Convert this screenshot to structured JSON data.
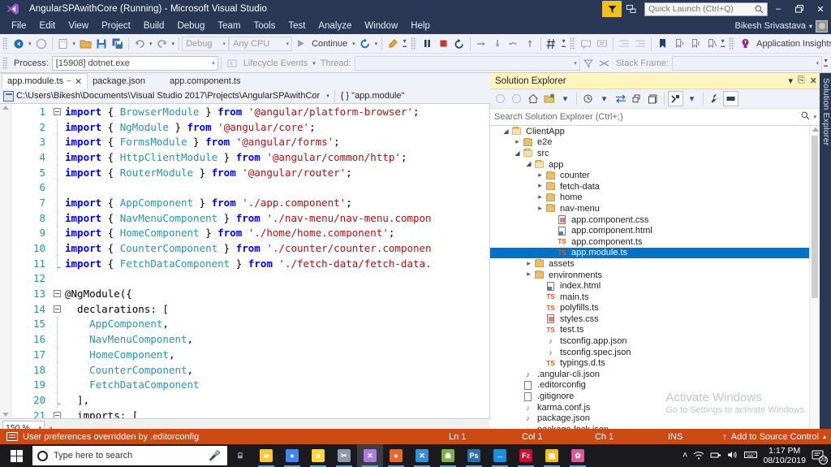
{
  "window": {
    "title": "AngularSPAwithCore (Running) - Microsoft Visual Studio",
    "minimize_label": "–",
    "restore_label": "❐",
    "close_label": "✕"
  },
  "menu": {
    "items": [
      "File",
      "Edit",
      "View",
      "Project",
      "Build",
      "Debug",
      "Team",
      "Tools",
      "Test",
      "Analyze",
      "Window",
      "Help"
    ],
    "user_name": "Bikesh Srivastava",
    "user_caret": "▾"
  },
  "quick_launch": {
    "placeholder": "Quick Launch (Ctrl+Q)"
  },
  "toolbar_main": {
    "navigate_back": "◀",
    "debug_config": "Debug",
    "platform": "Any CPU",
    "continue_label": "Continue",
    "restart": "↻",
    "pause": "‖",
    "stop": "■",
    "app_insights": "Application Insights",
    "caret": "▾"
  },
  "toolbar_debug": {
    "process_label": "Process:",
    "process_value": "[15908] dotnet.exe",
    "lifecycle_label": "Lifecycle Events",
    "thread_label": "Thread:",
    "thread_value": "",
    "stackframe_label": "Stack Frame:",
    "stackframe_value": ""
  },
  "tabs": [
    {
      "label": "app.module.ts",
      "active": true,
      "pin": "−",
      "close": "✕"
    },
    {
      "label": "package.json",
      "active": false
    },
    {
      "label": "app.component.ts",
      "active": false
    }
  ],
  "pathbar": {
    "path": "C:\\Users\\Bikesh\\Documents\\Visual Studio 2017\\Projects\\AngularSPAwithCor",
    "caret": "▾",
    "symbol": "{ }  \"app.module\""
  },
  "editor": {
    "zoom": "150 %",
    "lines": [
      {
        "n": "1",
        "fold": "minus",
        "tokens": [
          {
            "t": "import",
            "c": "k-import"
          },
          {
            "t": " { ",
            "c": "k-punct"
          },
          {
            "t": "BrowserModule",
            "c": "k-type"
          },
          {
            "t": " } ",
            "c": "k-punct"
          },
          {
            "t": "from",
            "c": "k-import"
          },
          {
            "t": " ",
            "c": "k-plain"
          },
          {
            "t": "'@angular/platform-browser'",
            "c": "k-str"
          },
          {
            "t": ";",
            "c": "k-punct"
          }
        ]
      },
      {
        "n": "2",
        "fold": "line",
        "tokens": [
          {
            "t": "import",
            "c": "k-import"
          },
          {
            "t": " { ",
            "c": "k-punct"
          },
          {
            "t": "NgModule",
            "c": "k-type"
          },
          {
            "t": " } ",
            "c": "k-punct"
          },
          {
            "t": "from",
            "c": "k-import"
          },
          {
            "t": " ",
            "c": "k-plain"
          },
          {
            "t": "'@angular/core'",
            "c": "k-str"
          },
          {
            "t": ";",
            "c": "k-punct"
          }
        ]
      },
      {
        "n": "3",
        "fold": "line",
        "tokens": [
          {
            "t": "import",
            "c": "k-import"
          },
          {
            "t": " { ",
            "c": "k-punct"
          },
          {
            "t": "FormsModule",
            "c": "k-type"
          },
          {
            "t": " } ",
            "c": "k-punct"
          },
          {
            "t": "from",
            "c": "k-import"
          },
          {
            "t": " ",
            "c": "k-plain"
          },
          {
            "t": "'@angular/forms'",
            "c": "k-str"
          },
          {
            "t": ";",
            "c": "k-punct"
          }
        ]
      },
      {
        "n": "4",
        "fold": "line",
        "tokens": [
          {
            "t": "import",
            "c": "k-import"
          },
          {
            "t": " { ",
            "c": "k-punct"
          },
          {
            "t": "HttpClientModule",
            "c": "k-type"
          },
          {
            "t": " } ",
            "c": "k-punct"
          },
          {
            "t": "from",
            "c": "k-import"
          },
          {
            "t": " ",
            "c": "k-plain"
          },
          {
            "t": "'@angular/common/http'",
            "c": "k-str"
          },
          {
            "t": ";",
            "c": "k-punct"
          }
        ]
      },
      {
        "n": "5",
        "fold": "line",
        "tokens": [
          {
            "t": "import",
            "c": "k-import"
          },
          {
            "t": " { ",
            "c": "k-punct"
          },
          {
            "t": "RouterModule",
            "c": "k-type"
          },
          {
            "t": " } ",
            "c": "k-punct"
          },
          {
            "t": "from",
            "c": "k-import"
          },
          {
            "t": " ",
            "c": "k-plain"
          },
          {
            "t": "'@angular/router'",
            "c": "k-str"
          },
          {
            "t": ";",
            "c": "k-punct"
          }
        ]
      },
      {
        "n": "6",
        "fold": "dot",
        "tokens": []
      },
      {
        "n": "7",
        "fold": "line",
        "tokens": [
          {
            "t": "import",
            "c": "k-import"
          },
          {
            "t": " { ",
            "c": "k-punct"
          },
          {
            "t": "AppComponent",
            "c": "k-type"
          },
          {
            "t": " } ",
            "c": "k-punct"
          },
          {
            "t": "from",
            "c": "k-import"
          },
          {
            "t": " ",
            "c": "k-plain"
          },
          {
            "t": "'./app.component'",
            "c": "k-str"
          },
          {
            "t": ";",
            "c": "k-punct"
          }
        ]
      },
      {
        "n": "8",
        "fold": "line",
        "tokens": [
          {
            "t": "import",
            "c": "k-import"
          },
          {
            "t": " { ",
            "c": "k-punct"
          },
          {
            "t": "NavMenuComponent",
            "c": "k-type"
          },
          {
            "t": " } ",
            "c": "k-punct"
          },
          {
            "t": "from",
            "c": "k-import"
          },
          {
            "t": " ",
            "c": "k-plain"
          },
          {
            "t": "'./nav-menu/nav-menu.compon",
            "c": "k-str"
          }
        ]
      },
      {
        "n": "9",
        "fold": "line",
        "tokens": [
          {
            "t": "import",
            "c": "k-import"
          },
          {
            "t": " { ",
            "c": "k-punct"
          },
          {
            "t": "HomeComponent",
            "c": "k-type"
          },
          {
            "t": " } ",
            "c": "k-punct"
          },
          {
            "t": "from",
            "c": "k-import"
          },
          {
            "t": " ",
            "c": "k-plain"
          },
          {
            "t": "'./home/home.component'",
            "c": "k-str"
          },
          {
            "t": ";",
            "c": "k-punct"
          }
        ]
      },
      {
        "n": "10",
        "fold": "line",
        "tokens": [
          {
            "t": "import",
            "c": "k-import"
          },
          {
            "t": " { ",
            "c": "k-punct"
          },
          {
            "t": "CounterComponent",
            "c": "k-type"
          },
          {
            "t": " } ",
            "c": "k-punct"
          },
          {
            "t": "from",
            "c": "k-import"
          },
          {
            "t": " ",
            "c": "k-plain"
          },
          {
            "t": "'./counter/counter.componen",
            "c": "k-str"
          }
        ]
      },
      {
        "n": "11",
        "fold": "line-end",
        "tokens": [
          {
            "t": "import",
            "c": "k-import"
          },
          {
            "t": " { ",
            "c": "k-punct"
          },
          {
            "t": "FetchDataComponent",
            "c": "k-type"
          },
          {
            "t": " } ",
            "c": "k-punct"
          },
          {
            "t": "from",
            "c": "k-import"
          },
          {
            "t": " ",
            "c": "k-plain"
          },
          {
            "t": "'./fetch-data/fetch-data.",
            "c": "k-str"
          }
        ]
      },
      {
        "n": "12",
        "fold": "none",
        "tokens": []
      },
      {
        "n": "13",
        "fold": "minus",
        "tokens": [
          {
            "t": "@NgModule({",
            "c": "k-decor"
          }
        ]
      },
      {
        "n": "14",
        "fold": "minus-inner",
        "tokens": [
          {
            "t": "  declarations: [",
            "c": "k-plain"
          }
        ]
      },
      {
        "n": "15",
        "fold": "dot-inner",
        "tokens": [
          {
            "t": "    ",
            "c": "k-plain"
          },
          {
            "t": "AppComponent",
            "c": "k-type"
          },
          {
            "t": ",",
            "c": "k-punct"
          }
        ]
      },
      {
        "n": "16",
        "fold": "dot-inner",
        "tokens": [
          {
            "t": "    ",
            "c": "k-plain"
          },
          {
            "t": "NavMenuComponent",
            "c": "k-type"
          },
          {
            "t": ",",
            "c": "k-punct"
          }
        ]
      },
      {
        "n": "17",
        "fold": "dot-inner",
        "tokens": [
          {
            "t": "    ",
            "c": "k-plain"
          },
          {
            "t": "HomeComponent",
            "c": "k-type"
          },
          {
            "t": ",",
            "c": "k-punct"
          }
        ]
      },
      {
        "n": "18",
        "fold": "dot-inner",
        "tokens": [
          {
            "t": "    ",
            "c": "k-plain"
          },
          {
            "t": "CounterComponent",
            "c": "k-type"
          },
          {
            "t": ",",
            "c": "k-punct"
          }
        ]
      },
      {
        "n": "19",
        "fold": "dot-inner",
        "tokens": [
          {
            "t": "    ",
            "c": "k-plain"
          },
          {
            "t": "FetchDataComponent",
            "c": "k-type"
          }
        ]
      },
      {
        "n": "20",
        "fold": "end-inner",
        "tokens": [
          {
            "t": "  ],",
            "c": "k-plain"
          }
        ]
      },
      {
        "n": "21",
        "fold": "minus-inner",
        "tokens": [
          {
            "t": "  imports: [",
            "c": "k-plain"
          }
        ]
      }
    ]
  },
  "solution_explorer": {
    "title": "Solution Explorer",
    "vertical_tab": "Solution Explorer",
    "search_placeholder": "Search Solution Explorer (Ctrl+;)",
    "title_buttons": {
      "dropdown": "▾",
      "pin": "⎘",
      "close": "✕"
    },
    "tree": [
      {
        "depth": 1,
        "twist": "open",
        "icon": "folder-open",
        "label": "ClientApp"
      },
      {
        "depth": 2,
        "twist": "closed",
        "icon": "folder",
        "label": "e2e"
      },
      {
        "depth": 2,
        "twist": "open",
        "icon": "folder-open",
        "label": "src"
      },
      {
        "depth": 3,
        "twist": "open",
        "icon": "folder-open",
        "label": "app"
      },
      {
        "depth": 4,
        "twist": "closed",
        "icon": "folder",
        "label": "counter"
      },
      {
        "depth": 4,
        "twist": "closed",
        "icon": "folder",
        "label": "fetch-data"
      },
      {
        "depth": 4,
        "twist": "closed",
        "icon": "folder",
        "label": "home"
      },
      {
        "depth": 4,
        "twist": "closed",
        "icon": "folder",
        "label": "nav-menu"
      },
      {
        "depth": 5,
        "twist": "none",
        "icon": "css",
        "label": "app.component.css"
      },
      {
        "depth": 5,
        "twist": "none",
        "icon": "html",
        "label": "app.component.html"
      },
      {
        "depth": 5,
        "twist": "none",
        "icon": "ts",
        "label": "app.component.ts"
      },
      {
        "depth": 5,
        "twist": "none",
        "icon": "ts",
        "label": "app.module.ts",
        "selected": true
      },
      {
        "depth": 3,
        "twist": "closed",
        "icon": "folder",
        "label": "assets"
      },
      {
        "depth": 3,
        "twist": "closed",
        "icon": "folder",
        "label": "environments"
      },
      {
        "depth": 4,
        "twist": "none",
        "icon": "html",
        "label": "index.html"
      },
      {
        "depth": 4,
        "twist": "none",
        "icon": "ts",
        "label": "main.ts"
      },
      {
        "depth": 4,
        "twist": "none",
        "icon": "ts",
        "label": "polyfills.ts"
      },
      {
        "depth": 4,
        "twist": "none",
        "icon": "css",
        "label": "styles.css"
      },
      {
        "depth": 4,
        "twist": "none",
        "icon": "ts",
        "label": "test.ts"
      },
      {
        "depth": 4,
        "twist": "none",
        "icon": "json",
        "label": "tsconfig.app.json"
      },
      {
        "depth": 4,
        "twist": "none",
        "icon": "json",
        "label": "tsconfig.spec.json"
      },
      {
        "depth": 4,
        "twist": "none",
        "icon": "ts",
        "label": "typings.d.ts"
      },
      {
        "depth": 2,
        "twist": "none",
        "icon": "json",
        "label": ".angular-cli.json"
      },
      {
        "depth": 2,
        "twist": "none",
        "icon": "doc",
        "label": ".editorconfig"
      },
      {
        "depth": 2,
        "twist": "none",
        "icon": "doc",
        "label": ".gitignore"
      },
      {
        "depth": 2,
        "twist": "none",
        "icon": "js",
        "label": "karma.conf.js"
      },
      {
        "depth": 2,
        "twist": "none",
        "icon": "json",
        "label": "package.json"
      },
      {
        "depth": 2,
        "twist": "none",
        "icon": "json",
        "label": "package-lock.json"
      }
    ]
  },
  "watermark": {
    "line1": "Activate Windows",
    "line2": "Go to Settings to activate Windows."
  },
  "status_bar": {
    "message": "User preferences overridden by .editorconfig",
    "ln": "Ln 1",
    "col": "Col 1",
    "ch": "Ch 1",
    "ins": "INS",
    "source_control": "Add to Source Control",
    "source_caret": "▴",
    "up_arrow": "↑",
    "bg_color": "#cc4a14"
  },
  "taskbar": {
    "search_placeholder": "Type here to search",
    "apps": [
      {
        "name": "task-view",
        "glyph": "⌸",
        "color": "#cfd2d8",
        "running": false
      },
      {
        "name": "file-explorer",
        "glyph": "▰",
        "color": "#ffc83d",
        "running": true
      },
      {
        "name": "google-chrome",
        "glyph": "●",
        "color": "#4285f4",
        "running": true
      },
      {
        "name": "sticky-notes",
        "glyph": "■",
        "color": "#ffd83d",
        "running": true
      },
      {
        "name": "snipping-tool",
        "glyph": "✂",
        "color": "#8d9aa8",
        "running": true
      },
      {
        "name": "visual-studio",
        "glyph": "✕",
        "color": "#a87ddb",
        "running": true,
        "active": true
      },
      {
        "name": "firefox",
        "glyph": "●",
        "color": "#e8682c",
        "running": true
      },
      {
        "name": "vs-code",
        "glyph": "✕",
        "color": "#3a8fd6",
        "running": true
      },
      {
        "name": "image-viewer",
        "glyph": "☗",
        "color": "#7fb24a",
        "running": true
      },
      {
        "name": "photoshop",
        "glyph": "Ps",
        "color": "#2e6fa8",
        "running": true
      },
      {
        "name": "teamviewer",
        "glyph": "↔",
        "color": "#1a8fe0",
        "running": true
      },
      {
        "name": "filezilla",
        "glyph": "Fz",
        "color": "#c8102e",
        "running": true
      },
      {
        "name": "picture-app",
        "glyph": "▣",
        "color": "#f0c020",
        "running": true
      },
      {
        "name": "paint",
        "glyph": "✿",
        "color": "#d85a9a",
        "running": true
      }
    ],
    "tray": {
      "chevron": "˄",
      "wifi": "◠",
      "network": "⌸",
      "volume": "ᴘ",
      "keyboard": "⌨",
      "time": "1:17 PM",
      "date": "08/10/2019",
      "notification_count": "20"
    }
  }
}
